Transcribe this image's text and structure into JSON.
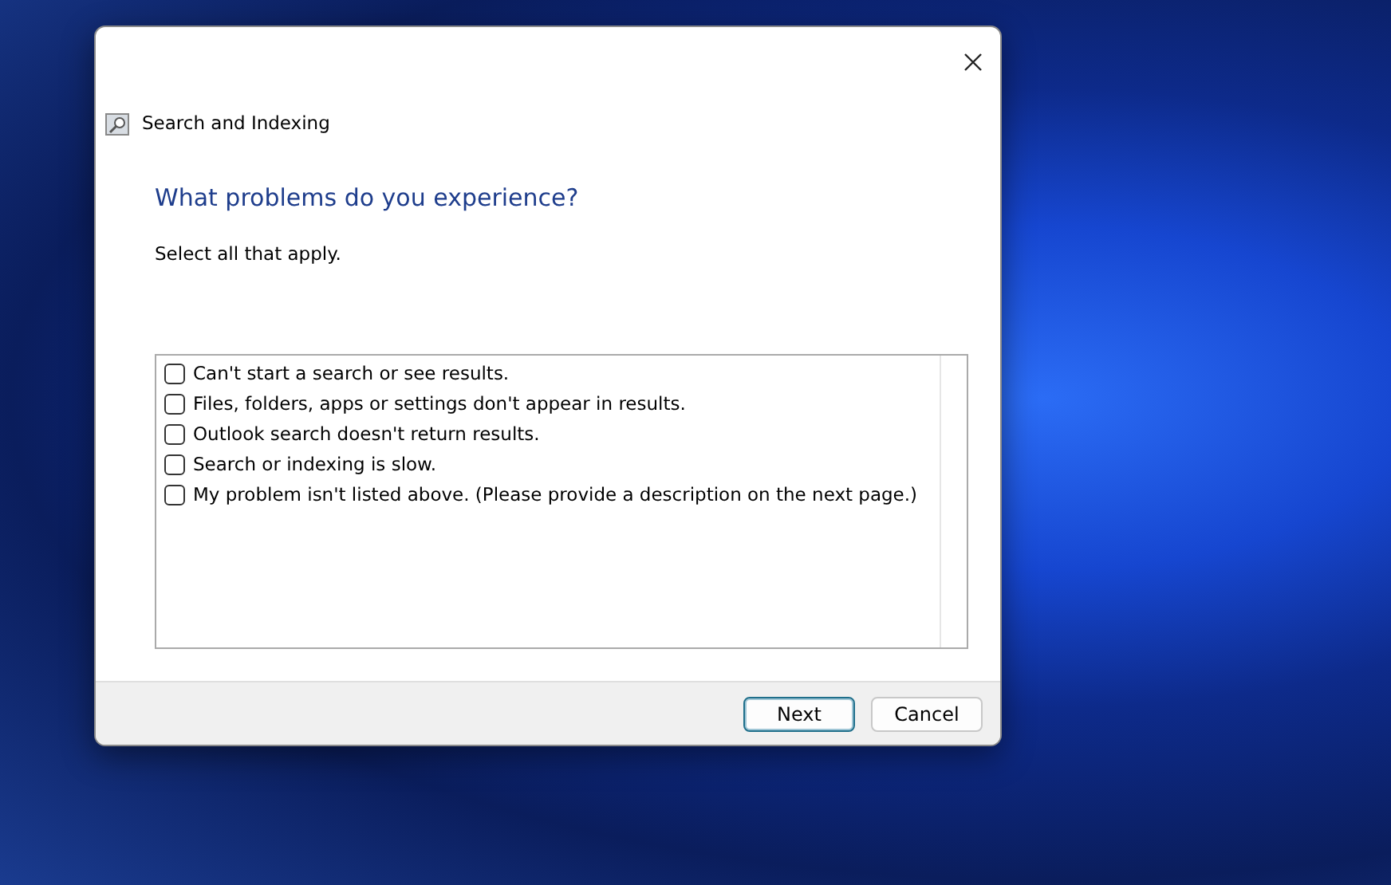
{
  "window": {
    "title": "Search and Indexing"
  },
  "heading": "What problems do you experience?",
  "instruction": "Select all that apply.",
  "options": [
    {
      "label": "Can't start a search or see results.",
      "checked": false
    },
    {
      "label": "Files, folders, apps or settings don't appear in results.",
      "checked": false
    },
    {
      "label": "Outlook search doesn't return results.",
      "checked": false
    },
    {
      "label": "Search or indexing is slow.",
      "checked": false
    },
    {
      "label": "My problem isn't listed above. (Please provide a description on the next page.)",
      "checked": false
    }
  ],
  "buttons": [
    {
      "label": "Next",
      "default": true
    },
    {
      "label": "Cancel",
      "default": false
    }
  ]
}
